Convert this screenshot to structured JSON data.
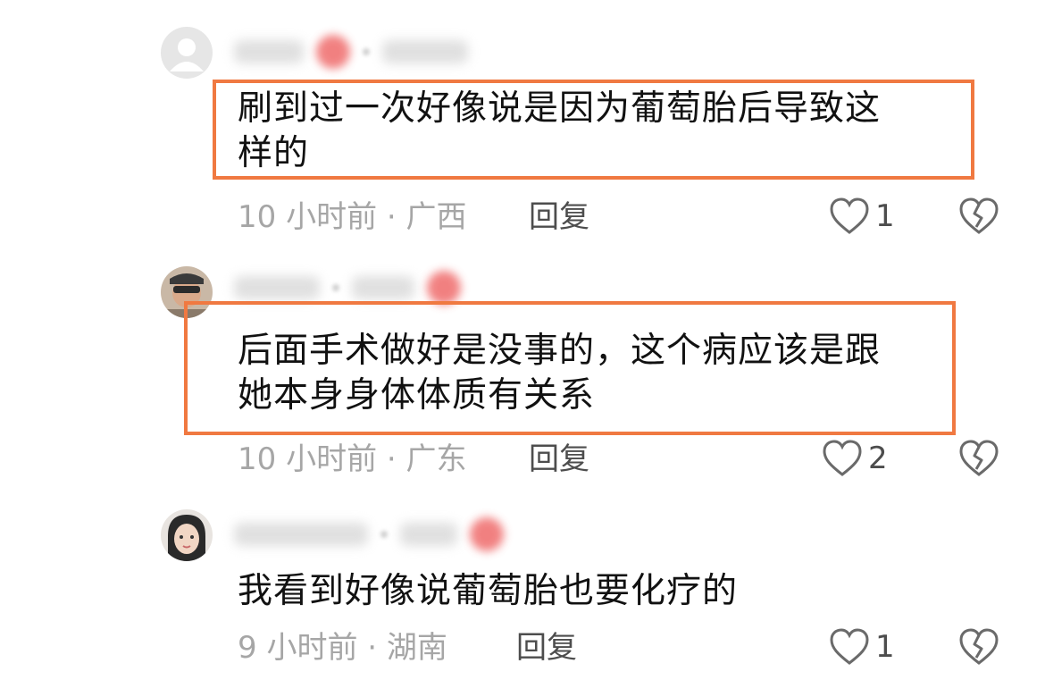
{
  "comments": [
    {
      "text": "刷到过一次好像说是因为葡萄胎后导致这\n样的",
      "time": "10 小时前 · 广西",
      "reply": "回复",
      "likes": "1",
      "highlighted": true,
      "avatar": "default-gray-avatar"
    },
    {
      "text": "后面手术做好是没事的，这个病应该是跟\n她本身身体体质有关系",
      "time": "10 小时前 · 广东",
      "reply": "回复",
      "likes": "2",
      "highlighted": true,
      "avatar": "user-photo-avatar"
    },
    {
      "text": "我看到好像说葡萄胎也要化疗的",
      "time": "9 小时前 · 湖南",
      "reply": "回复",
      "likes": "1",
      "highlighted": false,
      "avatar": "user-photo-avatar"
    }
  ],
  "icons": {
    "like": "heart-outline-icon",
    "dislike": "broken-heart-icon"
  },
  "colors": {
    "highlight_border": "#f07941",
    "meta_text": "#a6a6a6",
    "action_text": "#4d4d4d",
    "body_text": "#111111"
  }
}
